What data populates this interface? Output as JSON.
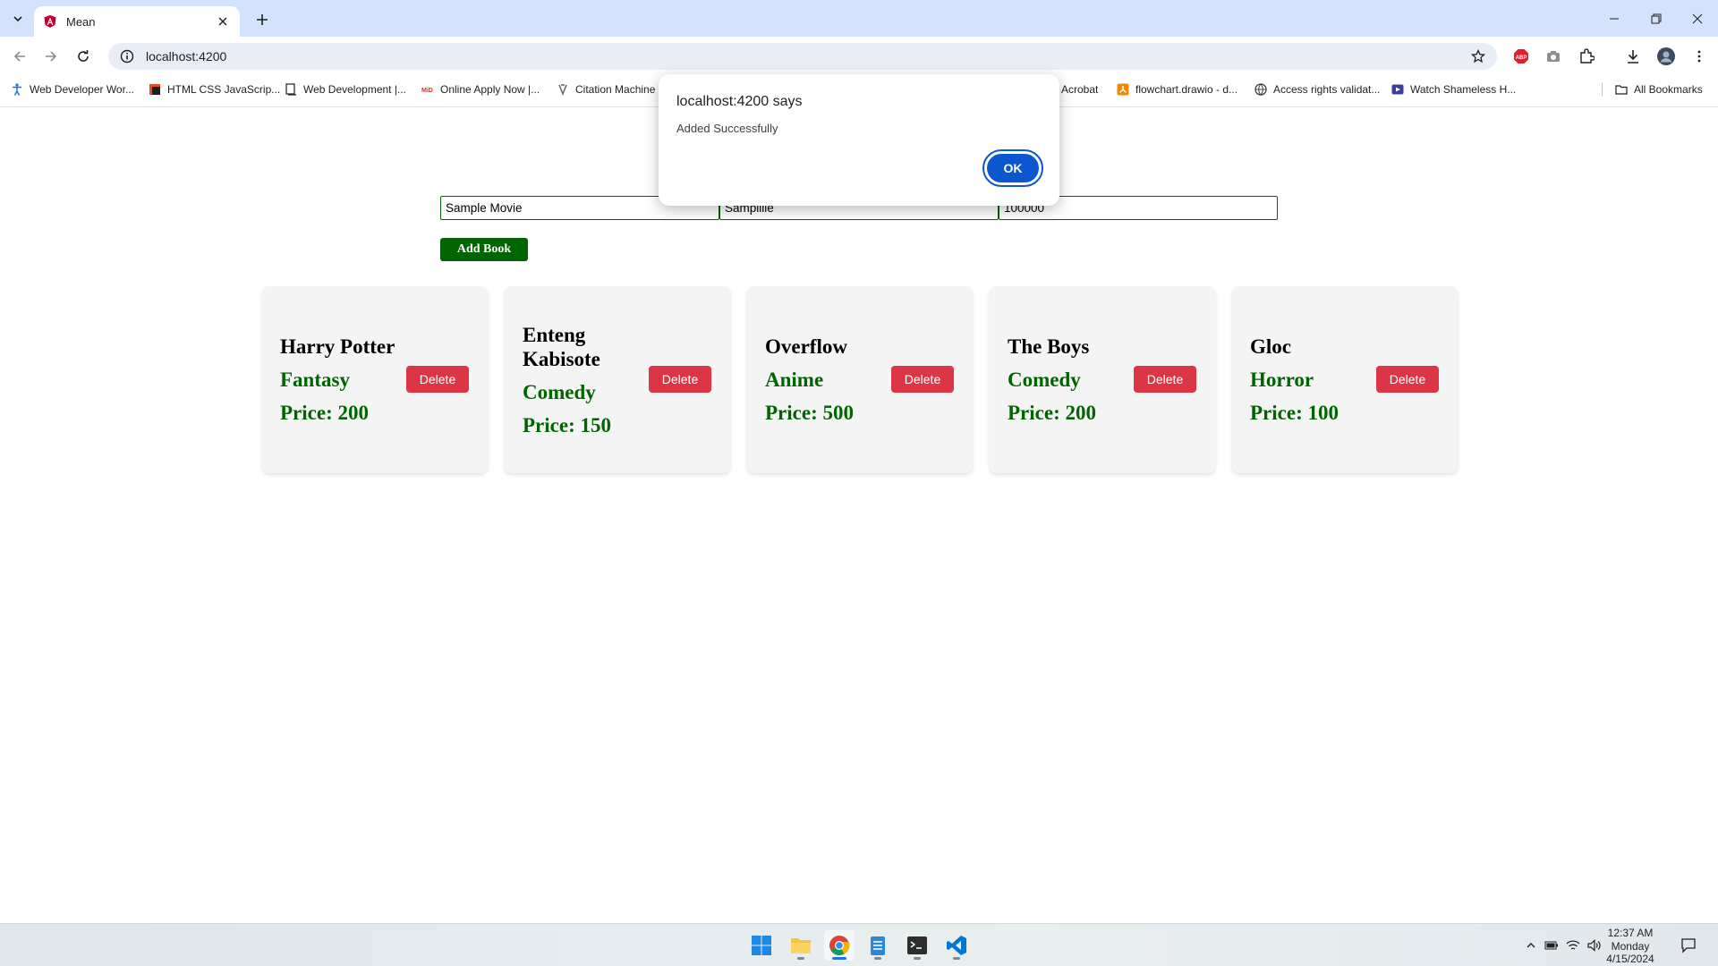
{
  "browser": {
    "tab_title": "Mean",
    "url": "localhost:4200",
    "bookmarks": [
      "Web Developer Wor...",
      "HTML CSS JavaScrip...",
      "Web Development |...",
      "Online Apply Now |...",
      "Citation Machine",
      "Acrobat",
      "flowchart.drawio - d...",
      "Access rights validat...",
      "Watch Shameless H..."
    ],
    "all_bookmarks": "All Bookmarks"
  },
  "form": {
    "name_value": "Sample Movie",
    "genre_value": "Samplllle",
    "price_value": "100000",
    "add_label": "Add Book"
  },
  "books": [
    {
      "name": "Harry Potter",
      "genre": "Fantasy",
      "price": "Price: 200"
    },
    {
      "name": "Enteng Kabisote",
      "genre": "Comedy",
      "price": "Price: 150"
    },
    {
      "name": "Overflow",
      "genre": "Anime",
      "price": "Price: 500"
    },
    {
      "name": "The Boys",
      "genre": "Comedy",
      "price": "Price: 200"
    },
    {
      "name": "Gloc",
      "genre": "Horror",
      "price": "Price: 100"
    }
  ],
  "delete_label": "Delete",
  "dialog": {
    "title": "localhost:4200 says",
    "message": "Added Successfully",
    "ok_label": "OK"
  },
  "taskbar": {
    "time": "12:37 AM",
    "day": "Monday",
    "date": "4/15/2024"
  },
  "colors": {
    "accent_green": "#006400",
    "delete_red": "#dc3545",
    "dialog_blue": "#0b57d0",
    "titlebar": "#d3e3fd"
  }
}
